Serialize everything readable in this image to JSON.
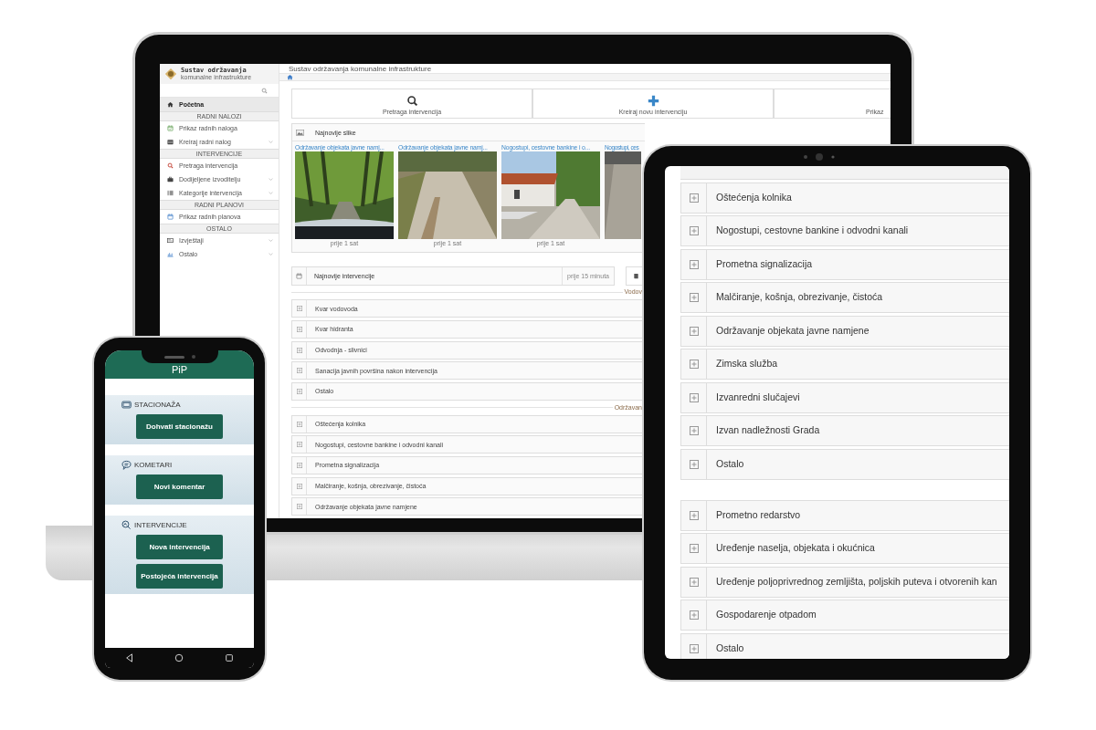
{
  "laptop": {
    "sidebar": {
      "logo_title": "Sustav održavanja",
      "logo_subtitle": "komunalne infrastrukture",
      "items": [
        {
          "kind": "item",
          "label": "Početna",
          "selected": true,
          "expandable": false
        },
        {
          "kind": "header",
          "label": "RADNI NALOZI"
        },
        {
          "kind": "item",
          "label": "Prikaz radnih naloga",
          "selected": false,
          "expandable": false
        },
        {
          "kind": "item",
          "label": "Kreiraj radni nalog",
          "selected": false,
          "expandable": true
        },
        {
          "kind": "header",
          "label": "INTERVENCIJE"
        },
        {
          "kind": "item",
          "label": "Pretraga intervencija",
          "selected": false,
          "expandable": false
        },
        {
          "kind": "item",
          "label": "Dodijeljene izvoditelju",
          "selected": false,
          "expandable": true
        },
        {
          "kind": "item",
          "label": "Kategorije intervencija",
          "selected": false,
          "expandable": true
        },
        {
          "kind": "header",
          "label": "RADNI PLANOVI"
        },
        {
          "kind": "item",
          "label": "Prikaz radnih planova",
          "selected": false,
          "expandable": false
        },
        {
          "kind": "header",
          "label": "OSTALO"
        },
        {
          "kind": "item",
          "label": "Izvještaji",
          "selected": false,
          "expandable": true
        },
        {
          "kind": "item",
          "label": "Ostalo",
          "selected": false,
          "expandable": true
        }
      ]
    },
    "title": "Sustav održavanja komunalne infrastrukture",
    "tiles": [
      {
        "label": "Pretraga intervencija"
      },
      {
        "label": "Kreiraj novu intervenciju"
      },
      {
        "label": "Prikaz"
      }
    ],
    "pictures_panel": {
      "title": "Najnovije slike",
      "items": [
        {
          "title": "Održavanje objekata javne namj...",
          "time": "prije 1 sat"
        },
        {
          "title": "Održavanje objekata javne namj...",
          "time": "prije 1 sat"
        },
        {
          "title": "Nogostupi, cestovne bankine i o...",
          "time": "prije 1 sat"
        },
        {
          "title": "Nogostupi, ces"
        }
      ]
    },
    "latest": {
      "title": "Najnovije intervencije",
      "time": "prije 15 minuta"
    },
    "groups": [
      {
        "label": "Vodov",
        "items": [
          "Kvar vodovoda",
          "Kvar hidranta",
          "Odvodnja - slivnici",
          "Sanacija javnih površina nakon intervencija",
          "Ostalo"
        ]
      },
      {
        "label": "Održavan",
        "items": [
          "Oštećenja kolnika",
          "Nogostupi, cestovne bankine i odvodni kanali",
          "Prometna signalizacija",
          "Malčiranje, košnja, obrezivanje, čistoća",
          "Održavanje objekata javne namjene"
        ]
      }
    ]
  },
  "phone": {
    "title": "PiP",
    "sections": [
      {
        "label": "STACIONAŽA",
        "buttons": [
          "Dohvati stacionažu"
        ]
      },
      {
        "label": "KOMETARI",
        "buttons": [
          "Novi komentar"
        ]
      },
      {
        "label": "INTERVENCIJE",
        "buttons": [
          "Nova intervencija",
          "Postojeća intervencija"
        ]
      }
    ]
  },
  "tablet": {
    "groups": [
      [
        "Oštećenja kolnika",
        "Nogostupi, cestovne bankine i odvodni kanali",
        "Prometna signalizacija",
        "Malčiranje, košnja, obrezivanje, čistoća",
        "Održavanje objekata javne namjene",
        "Zimska služba",
        "Izvanredni slučajevi",
        "Izvan nadležnosti Grada",
        "Ostalo"
      ],
      [
        "Prometno redarstvo",
        "Uređenje naselja, objekata i okućnica",
        "Uređenje poljoprivrednog zemljišta, poljskih puteva i otvorenih kan",
        "Gospodarenje otpadom",
        "Ostalo"
      ]
    ]
  }
}
